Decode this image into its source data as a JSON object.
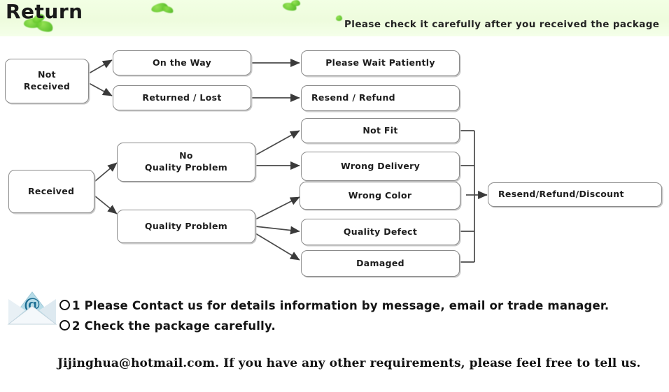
{
  "banner": {
    "title": "Return",
    "note": "Please check it carefully after you received the package",
    "bg_color": "#eefcdd",
    "leaf_color": "#62c72b"
  },
  "flowchart": {
    "nodes": {
      "not_received": "Not\nReceived",
      "on_the_way": "On the Way",
      "returned_lost": "Returned / Lost",
      "please_wait": "Please Wait Patiently",
      "resend_refund": "Resend / Refund",
      "received": "Received",
      "no_quality_problem": "No\nQuality Problem",
      "quality_problem": "Quality Problem",
      "not_fit": "Not Fit",
      "wrong_delivery": "Wrong Delivery",
      "wrong_color": "Wrong Color",
      "quality_defect": "Quality Defect",
      "damaged": "Damaged",
      "resend_refund_discount": "Resend/Refund/Discount"
    },
    "line_color": "#4a4a4a",
    "box_border_color": "#8b8b8b"
  },
  "footer": {
    "item1_marker": "1",
    "item1": "Please Contact us for details information by message, email or trade manager.",
    "item2_marker": "2",
    "item2": "Check the package carefully.",
    "contact": "Jijinghua@hotmail.com. If you have any other requirements, please feel free to tell us.",
    "envelope_icon": "at-envelope-icon"
  }
}
